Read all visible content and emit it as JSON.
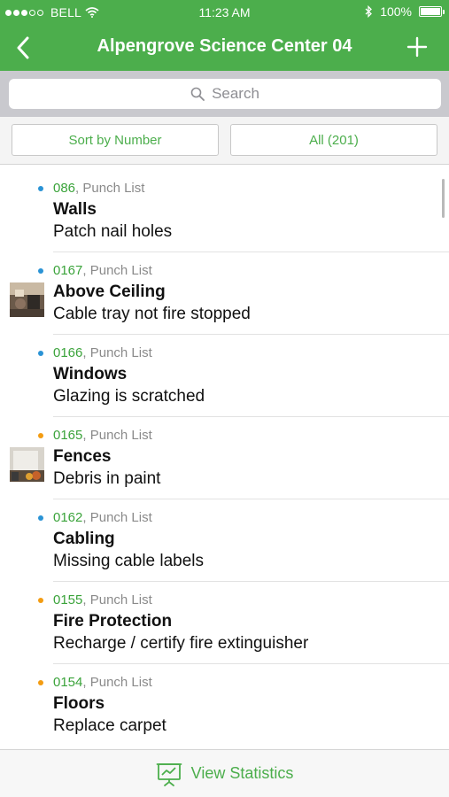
{
  "status_bar": {
    "carrier": "BELL",
    "time": "11:23 AM",
    "battery": "100%",
    "signal_icon": "signal-dots-icon",
    "wifi_icon": "wifi-icon",
    "bluetooth_icon": "bluetooth-icon",
    "battery_icon": "battery-icon"
  },
  "nav": {
    "title": "Alpengrove Science Center 04",
    "back_icon": "chevron-left-icon",
    "add_icon": "plus-icon"
  },
  "search": {
    "placeholder": "Search",
    "icon": "search-icon"
  },
  "filters": {
    "sort_label": "Sort by Number",
    "all_label": "All (201)"
  },
  "items": [
    {
      "number": "086",
      "type": "Punch List",
      "name": "Walls",
      "description": "Patch nail holes",
      "status_color": "#2a93d5",
      "thumbnail": false
    },
    {
      "number": "0167",
      "type": "Punch List",
      "name": "Above Ceiling",
      "description": "Cable tray not fire stopped",
      "status_color": "#2a93d5",
      "thumbnail": true
    },
    {
      "number": "0166",
      "type": "Punch List",
      "name": "Windows",
      "description": "Glazing is scratched",
      "status_color": "#2a93d5",
      "thumbnail": false
    },
    {
      "number": "0165",
      "type": "Punch List",
      "name": "Fences",
      "description": "Debris in paint",
      "status_color": "#f39c12",
      "thumbnail": true
    },
    {
      "number": "0162",
      "type": "Punch List",
      "name": "Cabling",
      "description": "Missing cable labels",
      "status_color": "#2a93d5",
      "thumbnail": false
    },
    {
      "number": "0155",
      "type": "Punch List",
      "name": "Fire Protection",
      "description": "Recharge / certify fire extinguisher",
      "status_color": "#f39c12",
      "thumbnail": false
    },
    {
      "number": "0154",
      "type": "Punch List",
      "name": "Floors",
      "description": "Replace carpet",
      "status_color": "#f39c12",
      "thumbnail": false
    }
  ],
  "bottom": {
    "label": "View Statistics",
    "icon": "presentation-chart-icon"
  },
  "colors": {
    "brand_green": "#4cae4c",
    "status_blue": "#2a93d5",
    "status_orange": "#f39c12"
  }
}
